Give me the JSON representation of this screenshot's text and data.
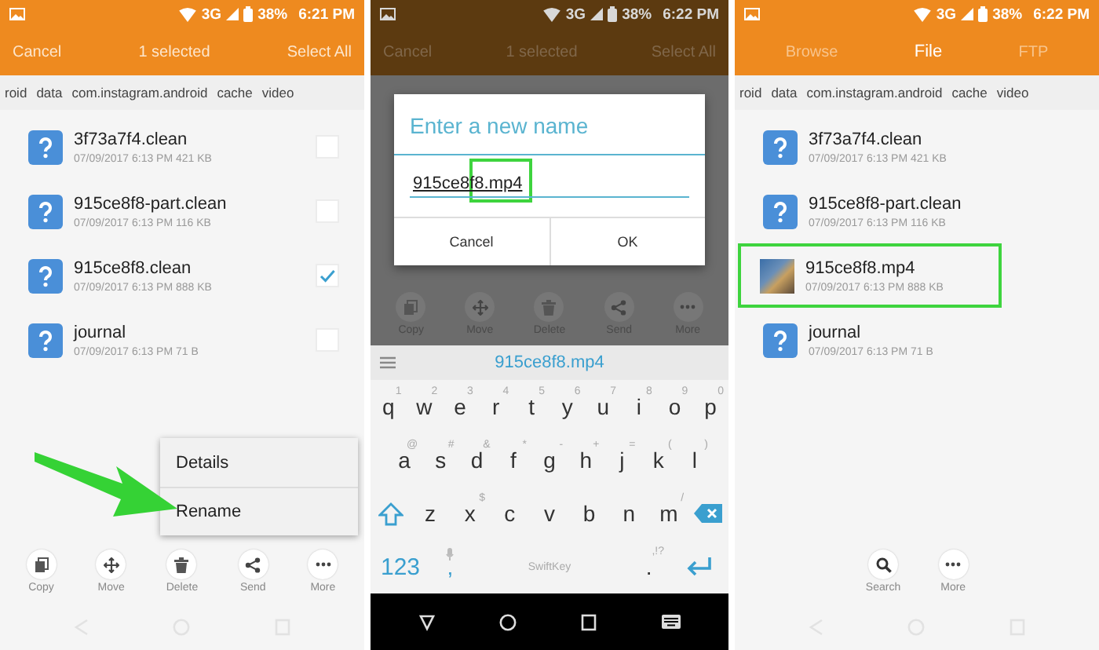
{
  "select_screen": {
    "status_bar": {
      "network": "3G",
      "battery": "38%",
      "time": "6:21 PM"
    },
    "action_bar": {
      "left": "Cancel",
      "title": "1 selected",
      "right": "Select All"
    },
    "breadcrumb": [
      "roid",
      "data",
      "com.instagram.android",
      "cache",
      "video"
    ],
    "files": [
      {
        "name": "3f73a7f4.clean",
        "meta": "07/09/2017 6:13 PM  421 KB",
        "checked": false
      },
      {
        "name": "915ce8f8-part.clean",
        "meta": "07/09/2017 6:13 PM  116 KB",
        "checked": false
      },
      {
        "name": "915ce8f8.clean",
        "meta": "07/09/2017 6:13 PM  888 KB",
        "checked": true
      },
      {
        "name": "journal",
        "meta": "07/09/2017 6:13 PM  71 B",
        "checked": false
      }
    ],
    "context_menu": [
      "Details",
      "Rename"
    ],
    "toolbar": [
      {
        "kind": "copy",
        "label": "Copy"
      },
      {
        "kind": "move",
        "label": "Move"
      },
      {
        "kind": "delete",
        "label": "Delete"
      },
      {
        "kind": "send",
        "label": "Send"
      },
      {
        "kind": "more",
        "label": "More"
      }
    ]
  },
  "rename_screen": {
    "status_bar": {
      "network": "3G",
      "battery": "38%",
      "time": "6:22 PM"
    },
    "action_bar": {
      "left": "Cancel",
      "title": "1 selected",
      "right": "Select All"
    },
    "dialog": {
      "title": "Enter a new name",
      "value": "915ce8f8.mp4",
      "buttons": [
        "Cancel",
        "OK"
      ]
    },
    "toolbar": [
      {
        "kind": "copy",
        "label": "Copy"
      },
      {
        "kind": "move",
        "label": "Move"
      },
      {
        "kind": "delete",
        "label": "Delete"
      },
      {
        "kind": "send",
        "label": "Send"
      },
      {
        "kind": "more",
        "label": "More"
      }
    ],
    "suggestion": "915ce8f8.mp4",
    "keyboard": {
      "rows": [
        [
          {
            "label": "q",
            "hint": "1"
          },
          {
            "label": "w",
            "hint": "2"
          },
          {
            "label": "e",
            "hint": "3"
          },
          {
            "label": "r",
            "hint": "4"
          },
          {
            "label": "t",
            "hint": "5"
          },
          {
            "label": "y",
            "hint": "6"
          },
          {
            "label": "u",
            "hint": "7"
          },
          {
            "label": "i",
            "hint": "8"
          },
          {
            "label": "o",
            "hint": "9"
          },
          {
            "label": "p",
            "hint": "0"
          }
        ],
        [
          {
            "label": "a",
            "hint": "@"
          },
          {
            "label": "s",
            "hint": "#"
          },
          {
            "label": "d",
            "hint": "&"
          },
          {
            "label": "f",
            "hint": "*"
          },
          {
            "label": "g",
            "hint": "-"
          },
          {
            "label": "h",
            "hint": "+"
          },
          {
            "label": "j",
            "hint": "="
          },
          {
            "label": "k",
            "hint": "("
          },
          {
            "label": "l",
            "hint": ")"
          }
        ],
        [
          {
            "label": "z"
          },
          {
            "label": "x",
            "hint": "$"
          },
          {
            "label": "c"
          },
          {
            "label": "v"
          },
          {
            "label": "b"
          },
          {
            "label": "n"
          },
          {
            "label": "m",
            "hint": "/"
          }
        ]
      ],
      "numbers": "123",
      "comma": ",",
      "brand": "SwiftKey",
      "period": ".",
      "period_hint": ",!?"
    }
  },
  "result_screen": {
    "status_bar": {
      "network": "3G",
      "battery": "38%",
      "time": "6:22 PM"
    },
    "tabs": [
      {
        "label": "Browse",
        "selected": false
      },
      {
        "label": "File",
        "selected": true
      },
      {
        "label": "FTP",
        "selected": false
      }
    ],
    "breadcrumb": [
      "roid",
      "data",
      "com.instagram.android",
      "cache",
      "video"
    ],
    "files": [
      {
        "name": "3f73a7f4.clean",
        "meta": "07/09/2017 6:13 PM  421 KB",
        "kind": "unknown",
        "highlighted": false
      },
      {
        "name": "915ce8f8-part.clean",
        "meta": "07/09/2017 6:13 PM  116 KB",
        "kind": "unknown",
        "highlighted": false
      },
      {
        "name": "915ce8f8.mp4",
        "meta": "07/09/2017 6:13 PM  888 KB",
        "kind": "video",
        "highlighted": true
      },
      {
        "name": "journal",
        "meta": "07/09/2017 6:13 PM  71 B",
        "kind": "unknown",
        "highlighted": false
      }
    ],
    "toolbar": [
      {
        "kind": "search",
        "label": "Search"
      },
      {
        "kind": "more",
        "label": "More"
      }
    ]
  }
}
